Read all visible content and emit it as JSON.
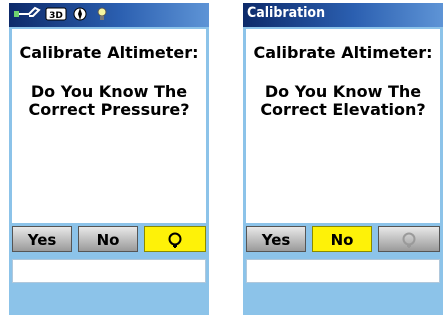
{
  "left": {
    "heading": "Calibrate Altimeter:",
    "question_line1": "Do You Know The",
    "question_line2": "Correct Pressure?",
    "buttons": {
      "yes": "Yes",
      "no": "No"
    },
    "selected": "restart"
  },
  "right": {
    "title": "Calibration",
    "heading": "Calibrate Altimeter:",
    "question_line1": "Do You Know The",
    "question_line2": "Correct Elevation?",
    "buttons": {
      "yes": "Yes",
      "no": "No"
    },
    "selected": "no"
  },
  "status_icons": [
    "satellite-icon",
    "3d-fix-icon",
    "compass-icon",
    "backlight-icon"
  ],
  "colors": {
    "screen_bg": "#8cc3e9",
    "title_bar": "#0d2a6a",
    "selected": "#fef208"
  }
}
